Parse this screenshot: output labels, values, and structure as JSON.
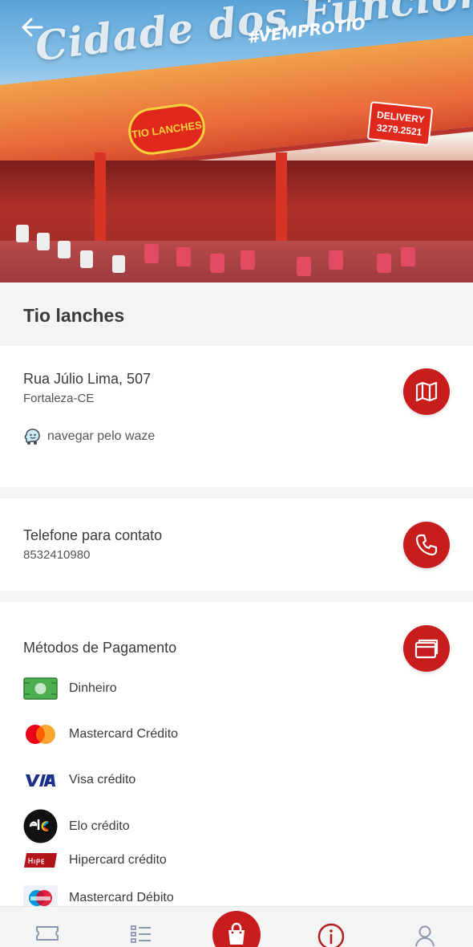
{
  "hero": {
    "script_text": "Cidade dos Funciona",
    "hashtag": "#VEMPROTIO",
    "logo_text": "TIO LANCHES",
    "delivery_text": "DELIVERY",
    "delivery_phone": "3279.2521"
  },
  "store": {
    "name": "Tio lanches"
  },
  "address": {
    "street": "Rua Júlio Lima, 507",
    "city": "Fortaleza-CE",
    "waze_label": "navegar pelo waze",
    "map_icon": "map-icon"
  },
  "phone": {
    "label": "Telefone para contato",
    "number": "8532410980",
    "icon": "phone-icon"
  },
  "payment": {
    "title": "Métodos de Pagamento",
    "icon": "wallet-icon",
    "methods": [
      {
        "label": "Dinheiro",
        "icon": "cash-icon"
      },
      {
        "label": "Mastercard Crédito",
        "icon": "mastercard-icon"
      },
      {
        "label": "Visa crédito",
        "icon": "visa-icon"
      },
      {
        "label": "Elo crédito",
        "icon": "elo-icon"
      },
      {
        "label": "Hipercard crédito",
        "icon": "hipercard-icon"
      },
      {
        "label": "Mastercard Débito",
        "icon": "maestro-icon"
      }
    ]
  },
  "nav": {
    "items": [
      "ticket-icon",
      "list-icon",
      "bag-icon",
      "info-icon",
      "user-icon"
    ],
    "accent": "#c81d1d"
  }
}
